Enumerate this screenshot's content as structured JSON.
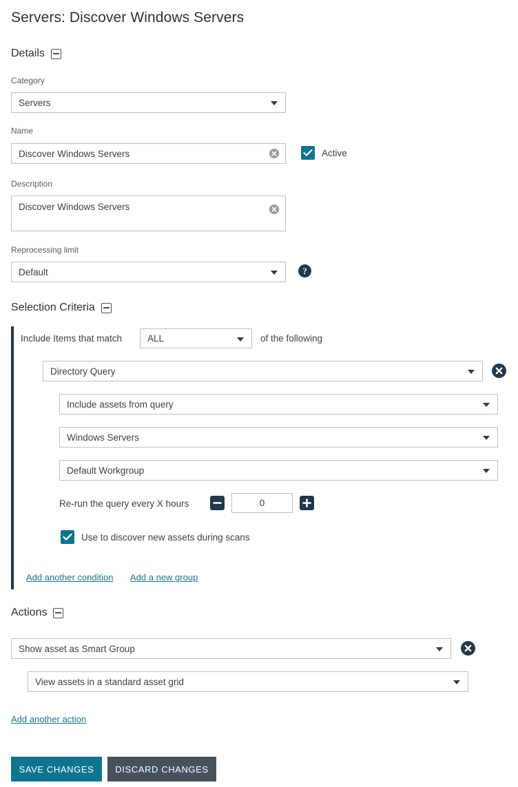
{
  "page": {
    "title": "Servers: Discover Windows Servers"
  },
  "details": {
    "heading": "Details",
    "category": {
      "label": "Category",
      "value": "Servers"
    },
    "name": {
      "label": "Name",
      "value": "Discover Windows Servers"
    },
    "active": {
      "label": "Active",
      "checked": true
    },
    "description": {
      "label": "Description",
      "value": "Discover Windows Servers"
    },
    "reprocessing_limit": {
      "label": "Reprocessing limit",
      "value": "Default"
    }
  },
  "selection_criteria": {
    "heading": "Selection Criteria",
    "match_prefix": "Include Items that match",
    "match_value": "ALL",
    "match_suffix": "of the following",
    "condition": {
      "type": "Directory Query",
      "mode": "Include assets from query",
      "query": "Windows Servers",
      "workgroup": "Default Workgroup",
      "rerun_label": "Re-run the query every X hours",
      "rerun_value": "0",
      "discover": {
        "label": "Use to discover new assets during scans",
        "checked": true
      }
    },
    "links": {
      "add_condition": "Add another condition",
      "add_group": "Add a new group"
    }
  },
  "actions": {
    "heading": "Actions",
    "action": "Show asset as Smart Group",
    "sub_action": "View assets in a standard asset grid",
    "add_action_link": "Add another action"
  },
  "footer": {
    "save": "SAVE CHANGES",
    "discard": "DISCARD CHANGES"
  },
  "colors": {
    "accent_teal": "#0e7490",
    "dark_navy": "#22384c",
    "link_teal": "#16778e",
    "secondary_gray": "#45525d",
    "border_gray": "#bcc0c4"
  }
}
